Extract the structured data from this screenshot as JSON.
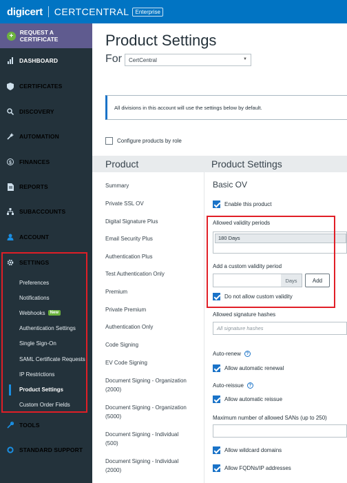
{
  "header": {
    "logo": "digicert",
    "product": "CERTCENTRAL",
    "edition": "Enterprise"
  },
  "sidebar": {
    "request_certificate": "REQUEST A CERTIFICATE",
    "items": [
      {
        "label": "DASHBOARD",
        "icon": "chart-icon"
      },
      {
        "label": "CERTIFICATES",
        "icon": "shield-icon"
      },
      {
        "label": "DISCOVERY",
        "icon": "search-icon"
      },
      {
        "label": "AUTOMATION",
        "icon": "wand-icon"
      },
      {
        "label": "FINANCES",
        "icon": "dollar-icon"
      },
      {
        "label": "REPORTS",
        "icon": "document-icon"
      },
      {
        "label": "SUBACCOUNTS",
        "icon": "hierarchy-icon"
      },
      {
        "label": "ACCOUNT",
        "icon": "user-icon"
      },
      {
        "label": "SETTINGS",
        "icon": "gear-icon"
      },
      {
        "label": "TOOLS",
        "icon": "wrench-icon"
      },
      {
        "label": "STANDARD SUPPORT",
        "icon": "lifebuoy-icon"
      }
    ],
    "settings_sub": [
      "Preferences",
      "Notifications",
      "Webhooks",
      "Authentication Settings",
      "Single Sign-On",
      "SAML Certificate Requests",
      "IP Restrictions",
      "Product Settings",
      "Custom Order Fields"
    ],
    "new_badge": "New",
    "active_sub": "Product Settings"
  },
  "main": {
    "title": "Product Settings",
    "for_label": "For",
    "division_select": "CertCentral",
    "info_text": "All divisions in this account will use the settings below by default.",
    "configure_by_role": "Configure products by role",
    "product_header": "Product",
    "settings_header": "Product Settings",
    "products": [
      "Summary",
      "Private SSL OV",
      "Digital Signature Plus",
      "Email Security Plus",
      "Authentication Plus",
      "Test Authentication Only",
      "Premium",
      "Private Premium",
      "Authentication Only",
      "Code Signing",
      "EV Code Signing",
      "Document Signing - Organization (2000)",
      "Document Signing - Organization (5000)",
      "Document Signing - Individual (500)",
      "Document Signing - Individual (2000)"
    ]
  },
  "settings": {
    "product_name": "Basic OV",
    "enable_product": "Enable this product",
    "allowed_validity_label": "Allowed validity periods",
    "validity_value": "180 Days",
    "custom_validity_label": "Add a custom validity period",
    "days_unit": "Days",
    "add_button": "Add",
    "no_custom_validity": "Do not allow custom validity",
    "sig_hashes_label": "Allowed signature hashes",
    "sig_hashes_placeholder": "All signature hashes",
    "auto_renew_label": "Auto-renew",
    "allow_auto_renewal": "Allow automatic renewal",
    "auto_reissue_label": "Auto-reissue",
    "allow_auto_reissue": "Allow automatic reissue",
    "max_sans_label": "Maximum number of allowed SANs (up to 250)",
    "allow_wildcard": "Allow wildcard domains",
    "allow_fqdn": "Allow FQDNs/IP addresses",
    "help_glyph": "?"
  },
  "colors": {
    "topbar": "#0174c3",
    "sidebar": "#23323b",
    "request_cert": "#5f5b8f",
    "highlight": "#e11e26",
    "checkbox": "#1a73c8"
  }
}
